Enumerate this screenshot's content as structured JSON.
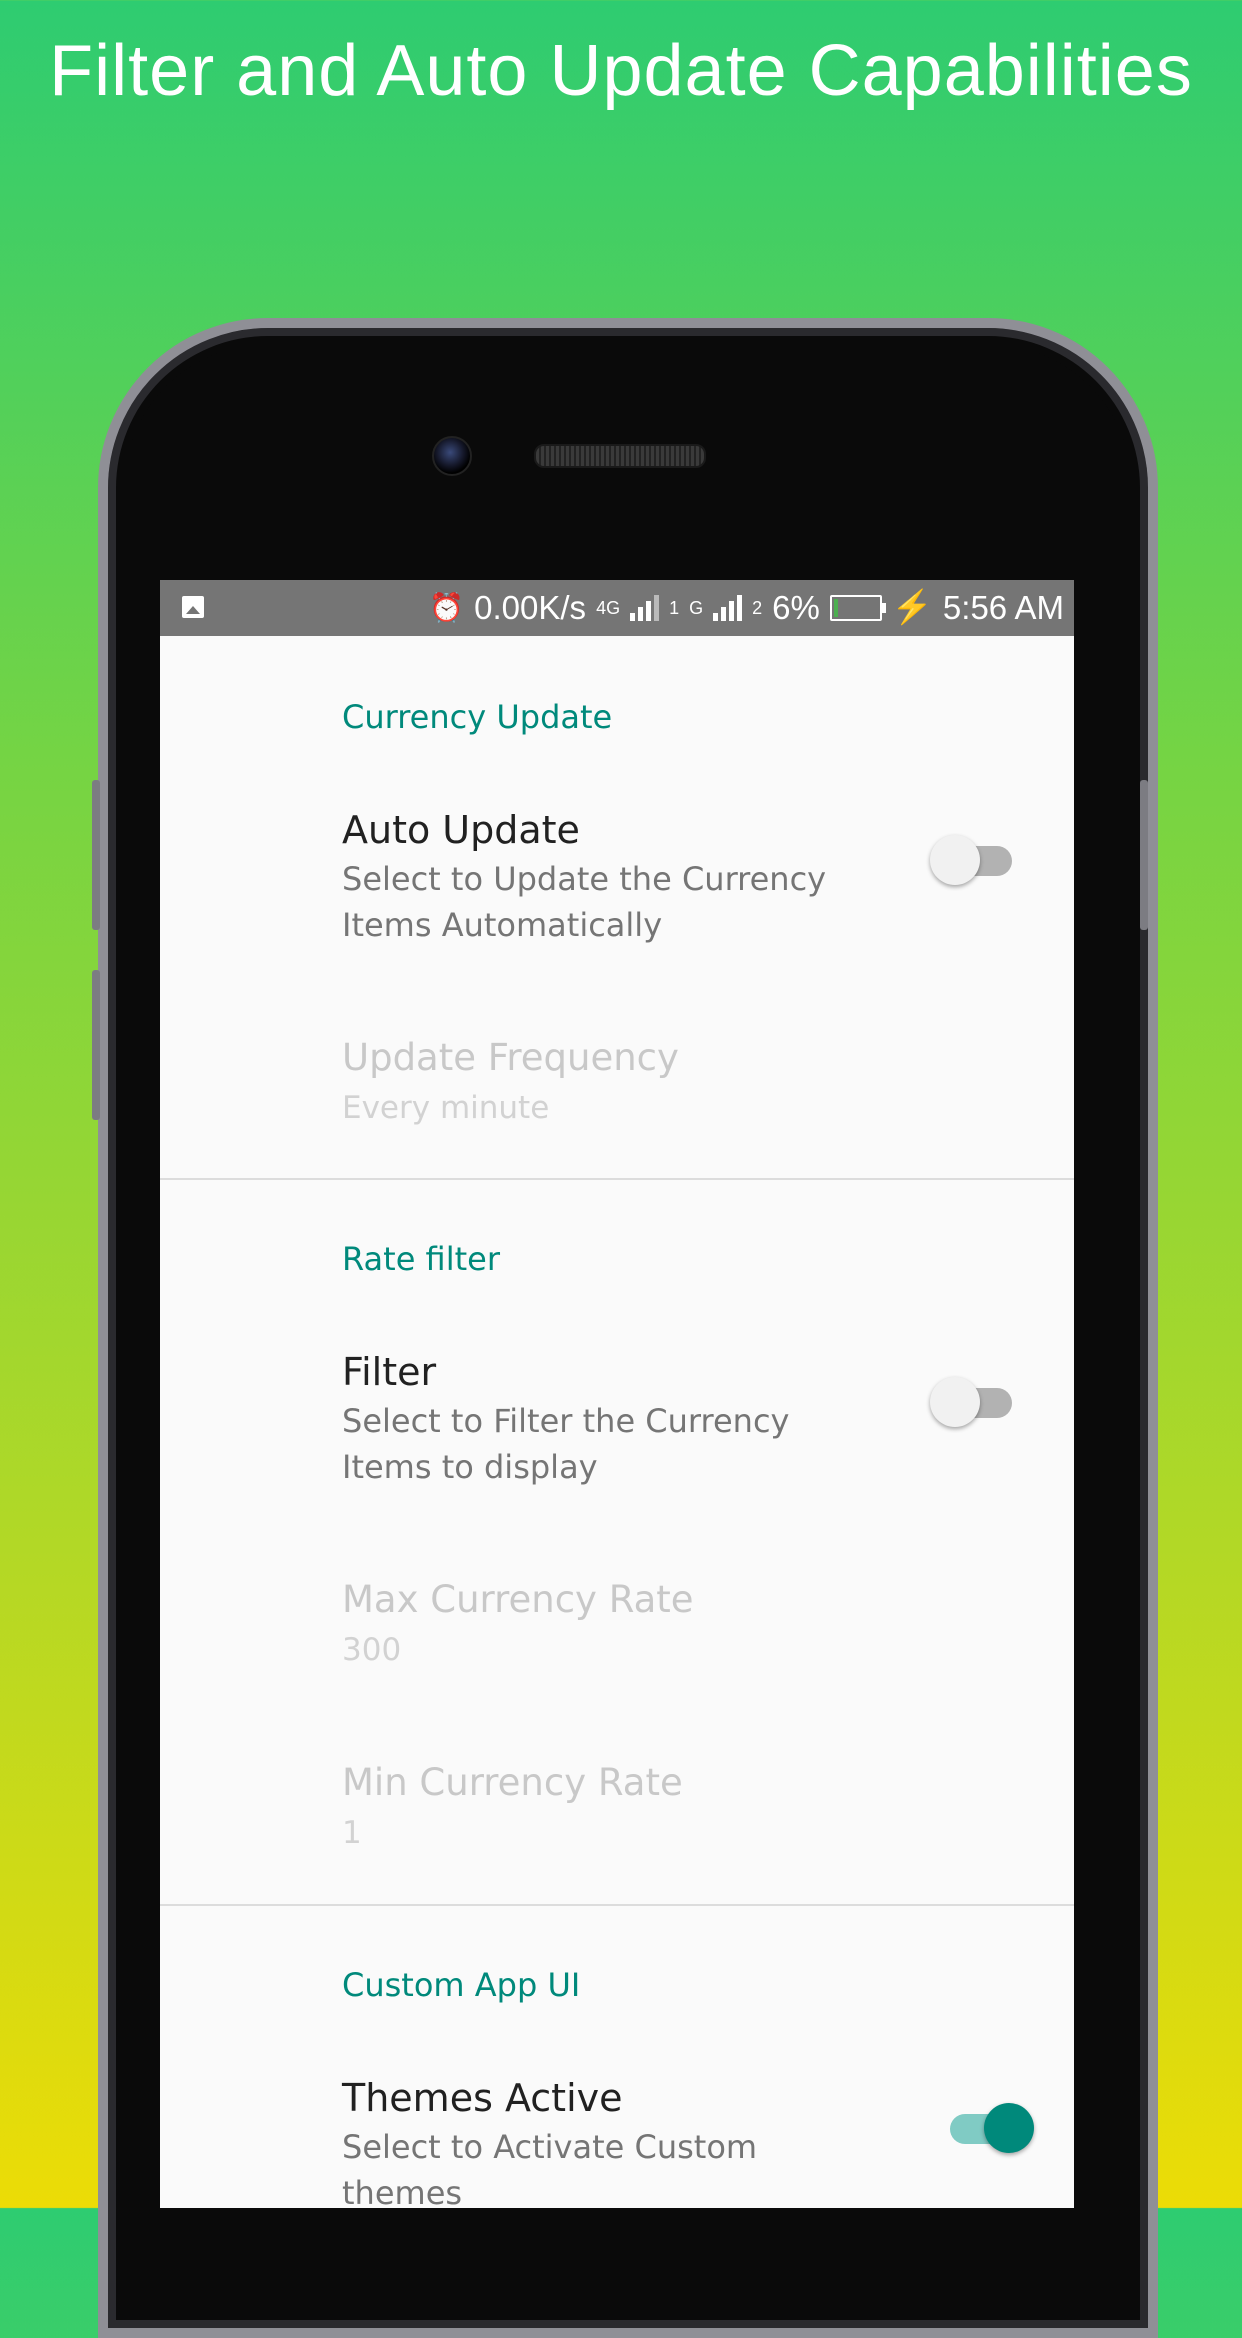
{
  "headline": "Filter and Auto Update Capabilities",
  "status_bar": {
    "net_speed": "0.00K/s",
    "sim1_network": "4G",
    "sim1_index": "1",
    "sim2_network": "G",
    "sim2_index": "2",
    "battery_percent": "6%",
    "time": "5:56 AM",
    "icons": [
      "image-icon",
      "alarm-icon",
      "signal-icon",
      "battery-icon",
      "charging-icon"
    ]
  },
  "sections": {
    "currency_update": {
      "title": "Currency Update",
      "auto_update": {
        "title": "Auto Update",
        "summary": "Select to Update the Currency Items Automatically",
        "enabled": false
      },
      "update_frequency": {
        "title": "Update Frequency",
        "value": "Every minute"
      }
    },
    "rate_filter": {
      "title": "Rate filter",
      "filter": {
        "title": "Filter",
        "summary": "Select to Filter the Currency Items to display",
        "enabled": false
      },
      "max_rate": {
        "title": "Max Currency Rate",
        "value": "300"
      },
      "min_rate": {
        "title": "Min Currency Rate",
        "value": "1"
      }
    },
    "custom_ui": {
      "title": "Custom App UI",
      "themes_active": {
        "title": "Themes Active",
        "summary": "Select to Activate Custom themes",
        "enabled": true
      }
    }
  },
  "colors": {
    "accent": "#00897b",
    "gradient_top": "#2ecc71",
    "gradient_bottom": "#ecdc06"
  }
}
